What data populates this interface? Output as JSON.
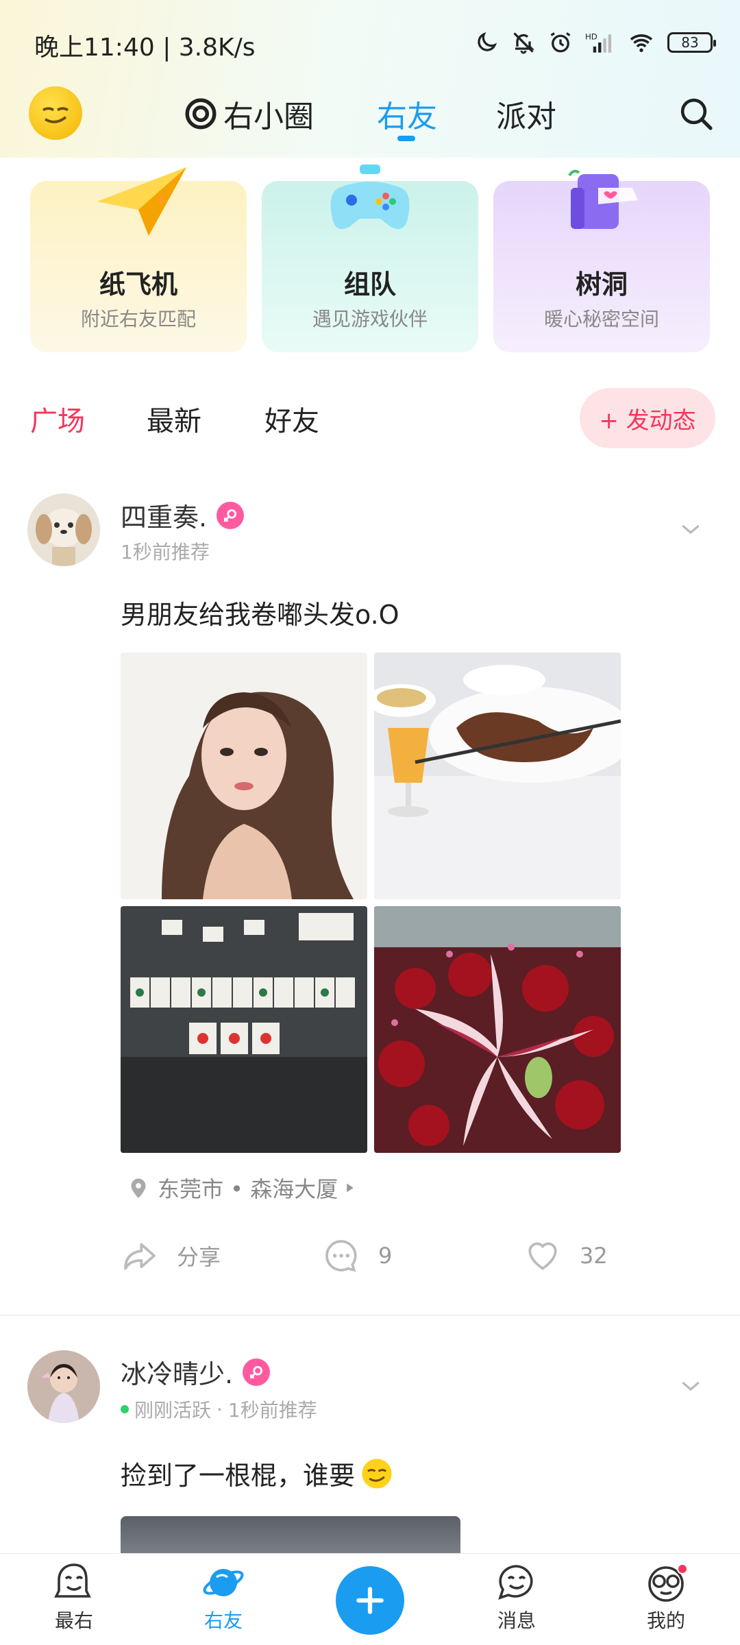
{
  "status_bar": {
    "time": "晚上11:40 | 3.8K/s",
    "battery": "83",
    "icons": [
      "moon-icon",
      "bell-off-icon",
      "alarm-icon",
      "signal-hd-icon",
      "wifi-icon",
      "battery-icon"
    ]
  },
  "top_nav": {
    "tabs": [
      {
        "label": "右小圈",
        "icon": "circle-target-icon"
      },
      {
        "label": "右友"
      },
      {
        "label": "派对"
      }
    ],
    "active_tab": "右友"
  },
  "feature_cards": [
    {
      "title": "纸飞机",
      "subtitle": "附近右友匹配",
      "icon": "paper-plane-icon"
    },
    {
      "title": "组队",
      "subtitle": "遇见游戏伙伴",
      "icon": "gamepad-icon"
    },
    {
      "title": "树洞",
      "subtitle": "暖心秘密空间",
      "icon": "mailbox-icon"
    }
  ],
  "filter_tabs": {
    "items": [
      "广场",
      "最新",
      "好友"
    ],
    "active": "广场",
    "post_button": "+ 发动态"
  },
  "posts": [
    {
      "username": "四重奏.",
      "meta": "1秒前推荐",
      "text": "男朋友给我卷嘟头发o.O",
      "photos": [
        "selfie-photo",
        "dinner-table-photo",
        "mahjong-photo",
        "flower-bouquet-photo"
      ],
      "location": "东莞市 • 森海大厦",
      "share_label": "分享",
      "comments": "9",
      "likes": "32"
    },
    {
      "username": "冰冷晴少.",
      "active_status": "刚刚活跃",
      "meta": "1秒前推荐",
      "text": "捡到了一根棍，谁要",
      "photos": [
        "partial-photo"
      ]
    }
  ],
  "bottom_nav": {
    "items": [
      {
        "label": "最右",
        "icon": "smile-face-icon"
      },
      {
        "label": "右友",
        "icon": "planet-icon"
      },
      {
        "label": "",
        "icon": "plus-icon"
      },
      {
        "label": "消息",
        "icon": "chat-face-icon"
      },
      {
        "label": "我的",
        "icon": "glasses-face-icon"
      }
    ],
    "active": "右友"
  },
  "colors": {
    "accent_blue": "#1a9cf0",
    "accent_red": "#f5365c",
    "female_badge": "#ff5aa0"
  }
}
